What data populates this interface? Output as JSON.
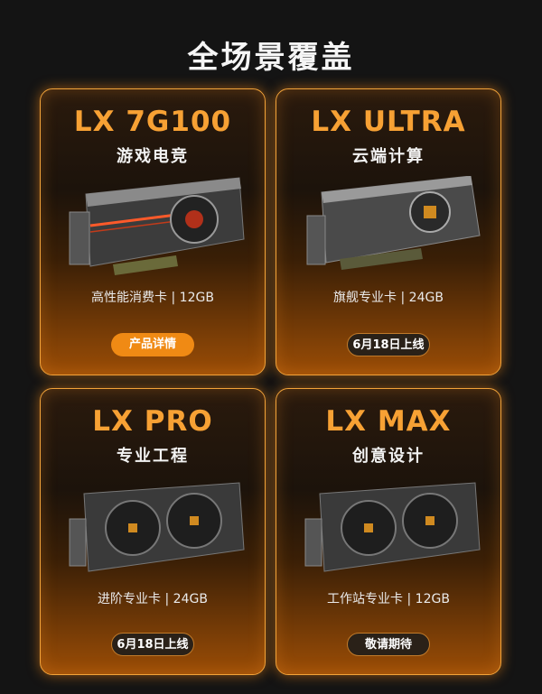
{
  "header": {
    "title": "全场景覆盖"
  },
  "cards": [
    {
      "name": "LX 7G100",
      "sub": "游戏电竞",
      "spec": "高性能消费卡 | 12GB",
      "button": "产品详情"
    },
    {
      "name": "LX ULTRA",
      "sub": "云端计算",
      "spec": "旗舰专业卡 | 24GB",
      "button": "6月18日上线"
    },
    {
      "name": "LX PRO",
      "sub": "专业工程",
      "spec": "进阶专业卡 | 24GB",
      "button": "6月18日上线"
    },
    {
      "name": "LX MAX",
      "sub": "创意设计",
      "spec": "工作站专业卡 | 12GB",
      "button": "敬请期待"
    }
  ],
  "colors": {
    "accent": "#f7a134",
    "button_orange": "#f08a14",
    "background": "#141414"
  }
}
